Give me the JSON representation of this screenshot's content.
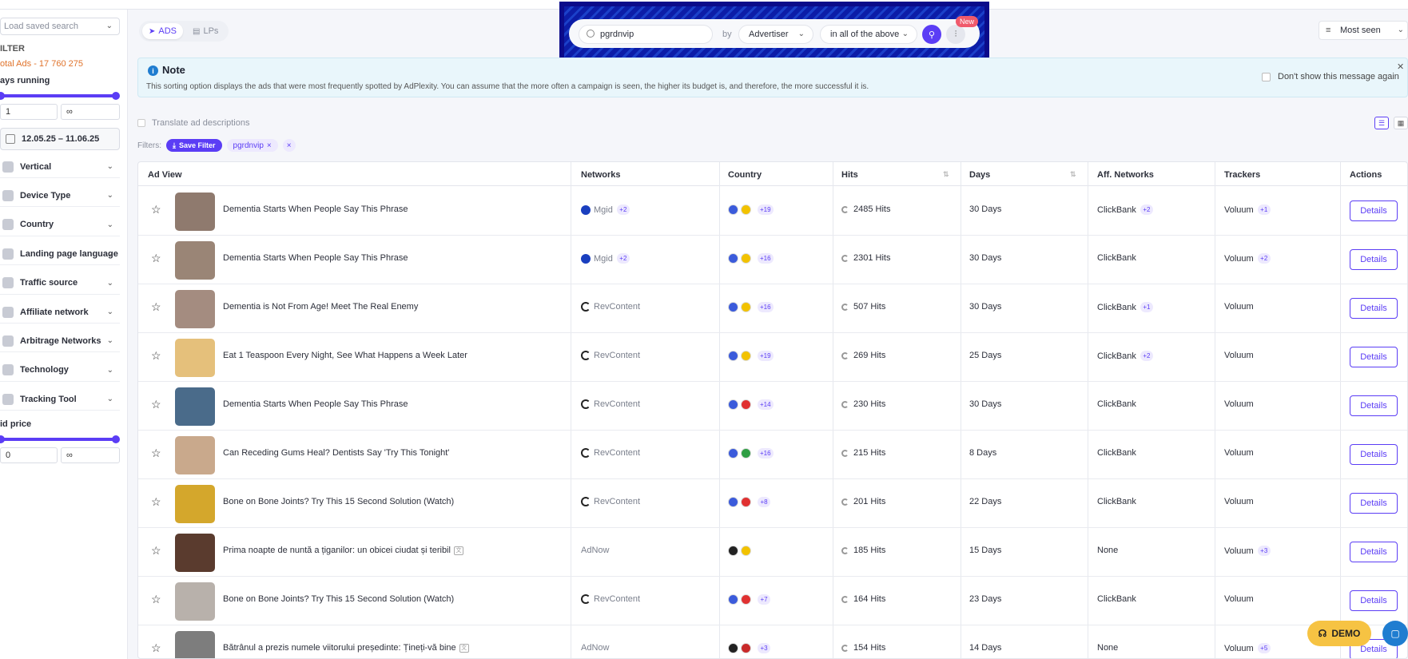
{
  "sidebar": {
    "saved_search_placeholder": "Load saved search",
    "filter_title": "ILTER",
    "total_ads": "otal Ads - 17 760 275",
    "days_running_label": "ays running",
    "days_min": "1",
    "days_max": "∞",
    "date_range": "12.05.25 – 11.06.25",
    "facets": [
      {
        "label": "Vertical",
        "icon": "vertical-icon"
      },
      {
        "label": "Device Type",
        "icon": "device-icon"
      },
      {
        "label": "Country",
        "icon": "globe-icon"
      },
      {
        "label": "Landing page language",
        "icon": "language-icon"
      },
      {
        "label": "Traffic source",
        "icon": "traffic-icon"
      },
      {
        "label": "Affiliate network",
        "icon": "affiliate-icon"
      },
      {
        "label": "Arbitrage Networks",
        "icon": "arbitrage-icon"
      },
      {
        "label": "Technology",
        "icon": "technology-icon"
      },
      {
        "label": "Tracking Tool",
        "icon": "tracking-icon"
      }
    ],
    "bid_price_label": "id price",
    "bid_min": "0",
    "bid_max": "∞"
  },
  "tabs": [
    {
      "label": "ADS",
      "active": true,
      "icon": "ads-icon"
    },
    {
      "label": "LPs",
      "active": false,
      "icon": "lps-icon"
    }
  ],
  "search": {
    "value": "pgrdnvip",
    "by_label": "by",
    "field": "Advertiser",
    "scope": "in all of the above",
    "new_badge": "New"
  },
  "sort": {
    "label": "Most seen"
  },
  "note": {
    "title": "Note",
    "text": "This sorting option displays the ads that were most frequently spotted by AdPlexity. You can assume that the more often a campaign is seen, the higher its budget is, and therefore, the more successful it is.",
    "dont_show": "Don't show this message again"
  },
  "translate_label": "Translate ad descriptions",
  "filters": {
    "label": "Filters:",
    "save_label": "Save Filter",
    "chip": "pgrdnvip"
  },
  "table": {
    "headers": [
      "Ad View",
      "Networks",
      "Country",
      "Hits",
      "Days",
      "Aff. Networks",
      "Trackers",
      "Actions"
    ],
    "rows": [
      {
        "title": "Dementia Starts When People Say This Phrase",
        "network": "Mgid",
        "net_type": "mgid",
        "net_plus": "+2",
        "flags": [
          "#3b5bdb",
          "#f2c200"
        ],
        "country_plus": "+19",
        "hits": "2485 Hits",
        "days": "30 Days",
        "aff": "ClickBank",
        "aff_plus": "+2",
        "tracker": "Voluum",
        "tracker_plus": "+1",
        "action": "Details",
        "thumb": "#8f7a6e",
        "ext": false
      },
      {
        "title": "Dementia Starts When People Say This Phrase",
        "network": "Mgid",
        "net_type": "mgid",
        "net_plus": "+2",
        "flags": [
          "#3b5bdb",
          "#f2c200"
        ],
        "country_plus": "+16",
        "hits": "2301 Hits",
        "days": "30 Days",
        "aff": "ClickBank",
        "aff_plus": "",
        "tracker": "Voluum",
        "tracker_plus": "+2",
        "action": "Details",
        "thumb": "#9a8576",
        "ext": false
      },
      {
        "title": "Dementia is Not From Age! Meet The Real Enemy",
        "network": "RevContent",
        "net_type": "rev",
        "net_plus": "",
        "flags": [
          "#3b5bdb",
          "#f2c200"
        ],
        "country_plus": "+16",
        "hits": "507 Hits",
        "days": "30 Days",
        "aff": "ClickBank",
        "aff_plus": "+1",
        "tracker": "Voluum",
        "tracker_plus": "",
        "action": "Details",
        "thumb": "#a48c80",
        "ext": false
      },
      {
        "title": "Eat 1 Teaspoon Every Night, See What Happens a Week Later",
        "network": "RevContent",
        "net_type": "rev",
        "net_plus": "",
        "flags": [
          "#3b5bdb",
          "#f2c200"
        ],
        "country_plus": "+19",
        "hits": "269 Hits",
        "days": "25 Days",
        "aff": "ClickBank",
        "aff_plus": "+2",
        "tracker": "Voluum",
        "tracker_plus": "",
        "action": "Details",
        "thumb": "#e5c07b",
        "ext": false
      },
      {
        "title": "Dementia Starts When People Say This Phrase",
        "network": "RevContent",
        "net_type": "rev",
        "net_plus": "",
        "flags": [
          "#3b5bdb",
          "#e03131"
        ],
        "country_plus": "+14",
        "hits": "230 Hits",
        "days": "30 Days",
        "aff": "ClickBank",
        "aff_plus": "",
        "tracker": "Voluum",
        "tracker_plus": "",
        "action": "Details",
        "thumb": "#4a6b8a",
        "ext": false
      },
      {
        "title": "Can Receding Gums Heal? Dentists Say 'Try This Tonight'",
        "network": "RevContent",
        "net_type": "rev",
        "net_plus": "",
        "flags": [
          "#3b5bdb",
          "#2f9e44"
        ],
        "country_plus": "+16",
        "hits": "215 Hits",
        "days": "8 Days",
        "aff": "ClickBank",
        "aff_plus": "",
        "tracker": "Voluum",
        "tracker_plus": "",
        "action": "Details",
        "thumb": "#c9a98c",
        "ext": false
      },
      {
        "title": "Bone on Bone Joints? Try This 15 Second Solution (Watch)",
        "network": "RevContent",
        "net_type": "rev",
        "net_plus": "",
        "flags": [
          "#3b5bdb",
          "#e03131"
        ],
        "country_plus": "+8",
        "hits": "201 Hits",
        "days": "22 Days",
        "aff": "ClickBank",
        "aff_plus": "",
        "tracker": "Voluum",
        "tracker_plus": "",
        "action": "Details",
        "thumb": "#d4a72c",
        "ext": false
      },
      {
        "title": "Prima noapte de nuntă a țiganilor: un obicei ciudat și teribil",
        "network": "AdNow",
        "net_type": "none",
        "net_plus": "",
        "flags": [
          "#222222",
          "#f2c200"
        ],
        "country_plus": "",
        "hits": "185 Hits",
        "days": "15 Days",
        "aff": "None",
        "aff_plus": "",
        "tracker": "Voluum",
        "tracker_plus": "+3",
        "action": "Details",
        "thumb": "#5a3b2e",
        "ext": true
      },
      {
        "title": "Bone on Bone Joints? Try This 15 Second Solution (Watch)",
        "network": "RevContent",
        "net_type": "rev",
        "net_plus": "",
        "flags": [
          "#3b5bdb",
          "#e03131"
        ],
        "country_plus": "+7",
        "hits": "164 Hits",
        "days": "23 Days",
        "aff": "ClickBank",
        "aff_plus": "",
        "tracker": "Voluum",
        "tracker_plus": "",
        "action": "Details",
        "thumb": "#b8b1ab",
        "ext": false
      },
      {
        "title": "Bătrânul a prezis numele viitorului președinte: Țineți-vă bine",
        "network": "AdNow",
        "net_type": "none",
        "net_plus": "",
        "flags": [
          "#222222",
          "#c92a2a"
        ],
        "country_plus": "+3",
        "hits": "154 Hits",
        "days": "14 Days",
        "aff": "None",
        "aff_plus": "",
        "tracker": "Voluum",
        "tracker_plus": "+5",
        "action": "Details",
        "thumb": "#7d7d7d",
        "ext": true
      }
    ]
  },
  "demo_label": "DEMO"
}
